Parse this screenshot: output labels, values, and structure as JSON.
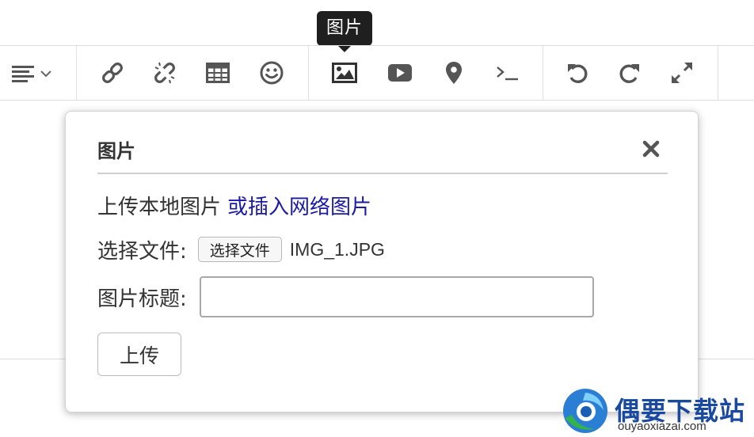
{
  "tooltip": {
    "text": "图片"
  },
  "toolbar": {
    "buttons": [
      {
        "icon": "align-dropdown-icon"
      },
      {
        "icon": "link-icon"
      },
      {
        "icon": "unlink-icon"
      },
      {
        "icon": "table-icon"
      },
      {
        "icon": "emoji-icon"
      },
      {
        "icon": "image-icon"
      },
      {
        "icon": "video-icon"
      },
      {
        "icon": "location-pin-icon"
      },
      {
        "icon": "code-icon"
      },
      {
        "icon": "undo-icon"
      },
      {
        "icon": "redo-icon"
      },
      {
        "icon": "fullscreen-icon"
      }
    ]
  },
  "dialog": {
    "title": "图片",
    "upload_local_label": "上传本地图片",
    "insert_network_link": "或插入网络图片",
    "choose_file_label": "选择文件:",
    "choose_file_button": "选择文件",
    "file_name": "IMG_1.JPG",
    "image_title_label": "图片标题:",
    "image_title_value": "",
    "upload_button": "上传"
  },
  "watermark": {
    "brand_text": "偶要下载站",
    "url": "ouyaoxiazai.com"
  },
  "colors": {
    "link": "#1a1aa6",
    "tooltip_bg": "#1f1f1f",
    "icon": "#555555"
  }
}
